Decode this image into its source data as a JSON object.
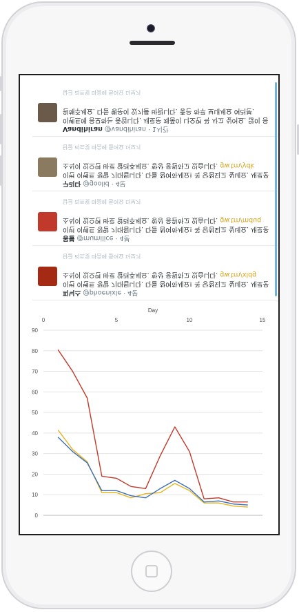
{
  "tweets": [
    {
      "name": "Vandihiran",
      "handle": "@vandihiran · 1시간",
      "text": "이벤트에 응모하는 중입니다. 새로운 제품이 나오면 꼭 사고 싶어요. 많이 응원해주세요. 다들 행운이 있기를 바랍니다. 좋은 하루 보내세요 여러분.",
      "link": "",
      "actions": "답글   리트윗   마음에 들어요   더보기",
      "avatar_color": "#6b5a4a"
    },
    {
      "name": "구리다",
      "handle": "@goolid · 4분",
      "text": "이번 이벤트 정말 기대됩니다. 다들 참여하세요! 꼭 당첨되고 싶네요. 새로운 소식이 있으면 바로 알려주세요. 항상 응원하고 있습니다.",
      "link": "gw.trn/ydk",
      "actions": "답글   리트윗   마음에 들어요   더보기",
      "avatar_color": "#8a7a60"
    },
    {
      "name": "몽블",
      "handle": "@mumilice · 4분",
      "text": "이번 이벤트 정말 기대됩니다. 다들 참여하세요! 꼭 당첨되고 싶네요. 새로운 소식이 있으면 바로 알려주세요. 항상 응원하고 있습니다.",
      "link": "gw.trn/mduq",
      "actions": "답글   리트윗   마음에 들어요   더보기",
      "avatar_color": "#c0392b"
    },
    {
      "name": "피닉스",
      "handle": "@phoenixle · 4분",
      "text": "이번 이벤트 정말 기대됩니다. 다들 참여하세요! 꼭 당첨되고 싶네요. 새로운 소식이 있으면 바로 알려주세요. 항상 응원하고 있습니다.",
      "link": "gw.trn/xldg",
      "actions": "답글   리트윗   마음에 들어요   더보기",
      "avatar_color": "#a52a14"
    }
  ],
  "chart_data": {
    "type": "line",
    "title": "",
    "xlabel": "Day",
    "ylabel": "",
    "x_axis_position": "top",
    "xlim": [
      0,
      15
    ],
    "ylim": [
      0,
      90
    ],
    "xticks": [
      0,
      5,
      10,
      15
    ],
    "yticks": [
      0,
      10,
      20,
      30,
      40,
      50,
      60,
      70,
      80,
      90
    ],
    "grid": true,
    "legend": "none",
    "x": [
      1,
      2,
      3,
      4,
      5,
      6,
      7,
      8,
      9,
      10,
      11,
      12,
      13,
      14
    ],
    "series": [
      {
        "color": "#c0392b",
        "values": [
          80.5,
          70,
          57,
          19,
          18,
          14,
          13,
          29,
          43,
          31,
          8,
          8.5,
          6.5,
          6.5
        ]
      },
      {
        "color": "#e6b422",
        "values": [
          41.5,
          32,
          26,
          11,
          11,
          8.5,
          10.5,
          11,
          15.5,
          12,
          6,
          6,
          4.5,
          4
        ]
      },
      {
        "color": "#3a6fb7",
        "values": [
          38,
          31,
          25.5,
          12,
          12,
          9.5,
          8.5,
          13,
          17,
          13,
          6.5,
          7,
          5.5,
          5
        ]
      }
    ]
  }
}
